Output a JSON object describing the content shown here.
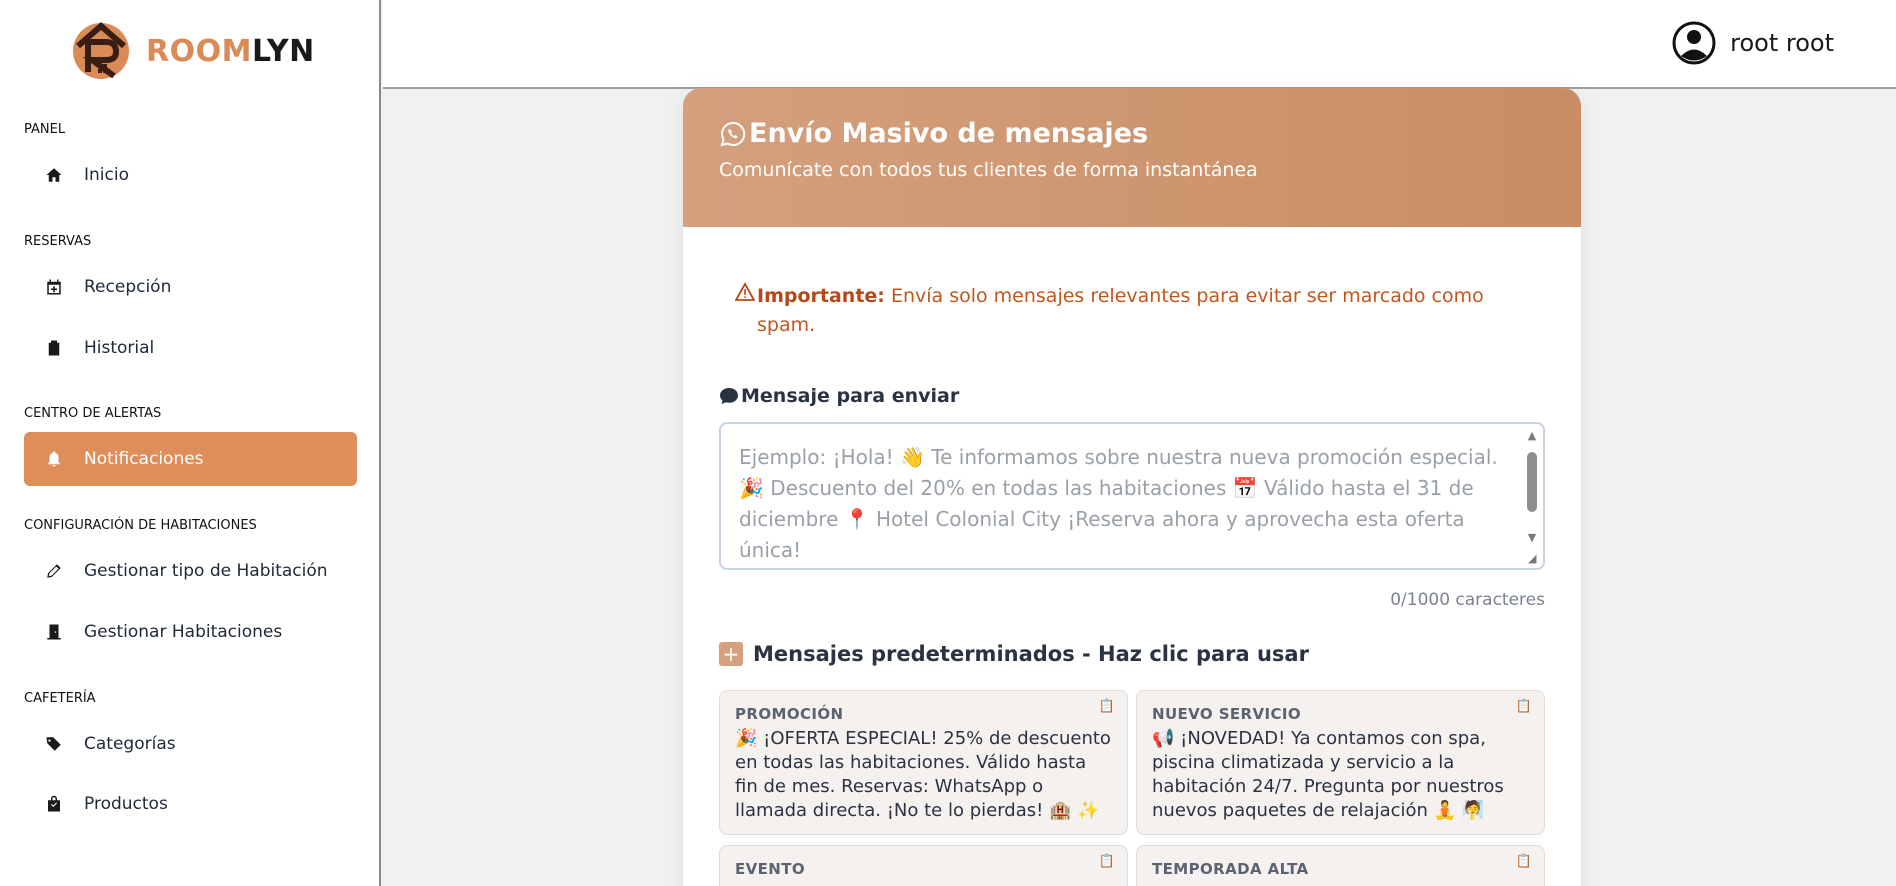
{
  "brand": {
    "part1": "ROOM",
    "part2": "LYN"
  },
  "user": {
    "name": "root root"
  },
  "sidebar": {
    "sections": [
      {
        "label": "PANEL"
      },
      {
        "label": "RESERVAS"
      },
      {
        "label": "CENTRO DE ALERTAS"
      },
      {
        "label": "CONFIGURACIÓN DE HABITACIONES"
      },
      {
        "label": "CAFETERÍA"
      }
    ],
    "items": [
      {
        "label": "Inicio",
        "icon": "home-icon"
      },
      {
        "label": "Recepción",
        "icon": "calendar-plus-icon"
      },
      {
        "label": "Historial",
        "icon": "clipboard-icon"
      },
      {
        "label": "Notificaciones",
        "icon": "bell-icon",
        "active": true
      },
      {
        "label": "Gestionar tipo de Habitación",
        "icon": "pencil-icon"
      },
      {
        "label": "Gestionar Habitaciones",
        "icon": "door-icon"
      },
      {
        "label": "Categorías",
        "icon": "tags-icon"
      },
      {
        "label": "Productos",
        "icon": "bag-icon"
      }
    ]
  },
  "card": {
    "title": "Envío Masivo de mensajes",
    "subtitle": "Comunícate con todos tus clientes de forma instantánea",
    "warning_label": "Importante:",
    "warning_text": "Envía solo mensajes relevantes para evitar ser marcado como spam.",
    "message_label": "Mensaje para enviar",
    "message_value": "",
    "message_placeholder": "Ejemplo: ¡Hola! 👋 Te informamos sobre nuestra nueva promoción especial. 🎉 Descuento del 20% en todas las habitaciones 📅 Válido hasta el 31 de diciembre 📍 Hotel Colonial City ¡Reserva ahora y aprovecha esta oferta única!",
    "counter": "0/1000 caracteres",
    "presets_heading": "Mensajes predeterminados - Haz clic para usar",
    "presets": [
      {
        "title": "PROMOCIÓN",
        "text": "🎉 ¡OFERTA ESPECIAL! 25% de descuento en todas las habitaciones. Válido hasta fin de mes. Reservas: WhatsApp o llamada directa. ¡No te lo pierdas! 🏨 ✨"
      },
      {
        "title": "NUEVO SERVICIO",
        "text": "📢 ¡NOVEDAD! Ya contamos con spa, piscina climatizada y servicio a la habitación 24/7. Pregunta por nuestros nuevos paquetes de relajación 🧘 🧖"
      },
      {
        "title": "EVENTO",
        "text": ""
      },
      {
        "title": "TEMPORADA ALTA",
        "text": ""
      }
    ]
  },
  "colors": {
    "accent": "#dd8e5b",
    "header_start": "#d4a07d",
    "header_end": "#c98d63",
    "warning": "#c2571d"
  }
}
